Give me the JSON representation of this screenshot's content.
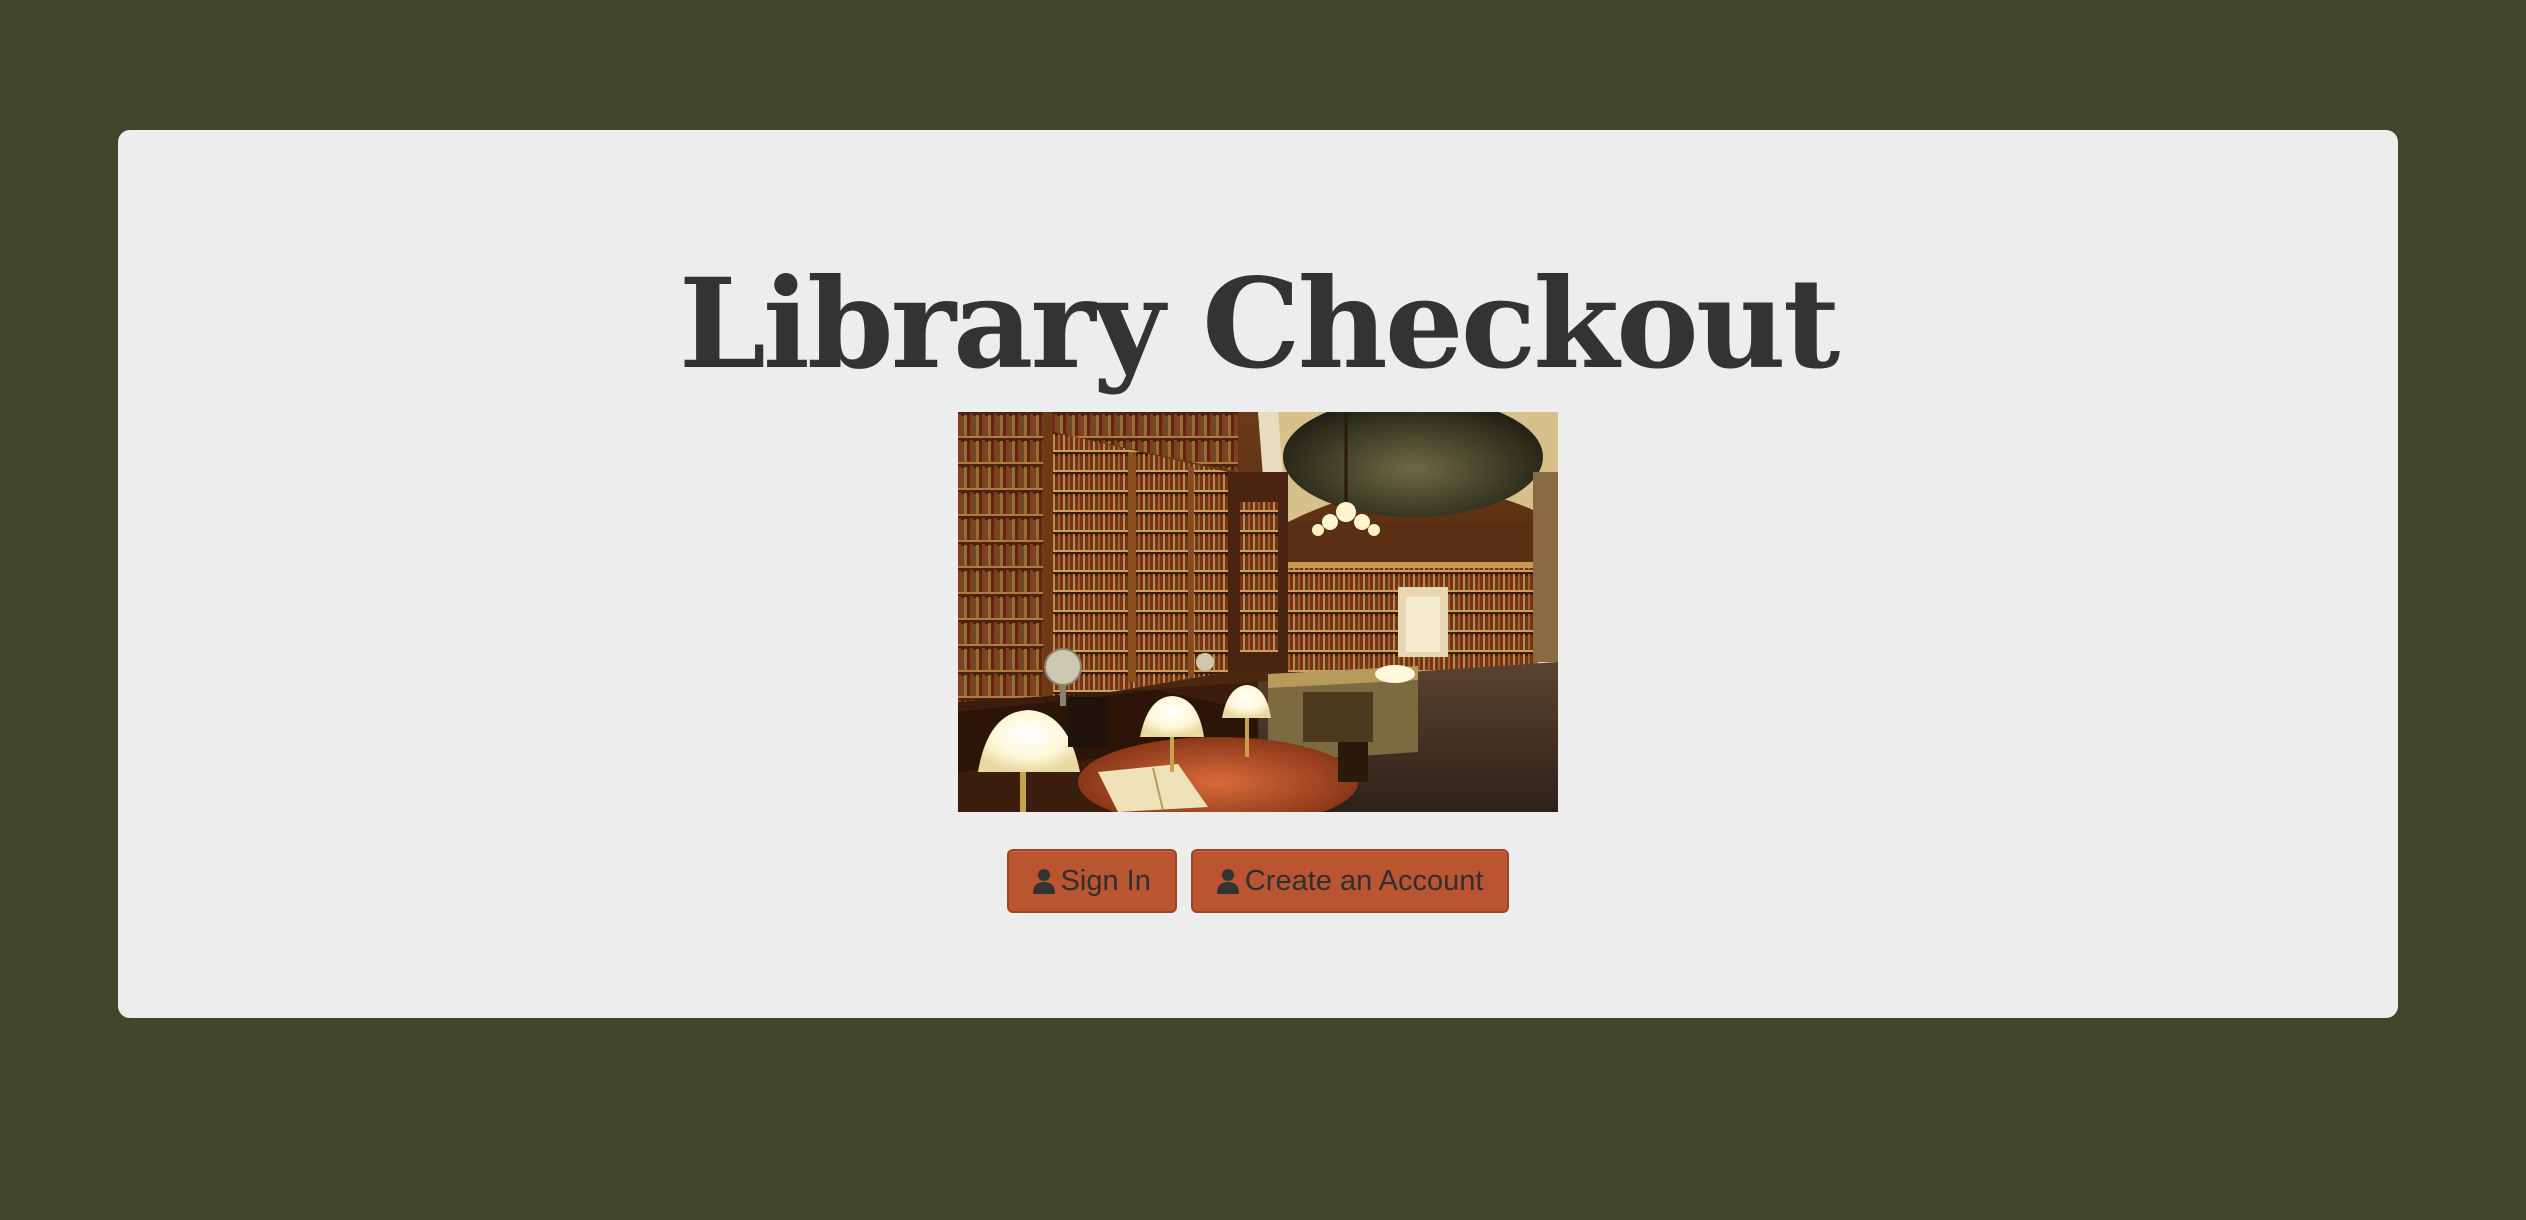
{
  "colors": {
    "background": "#41472b",
    "card": "#ededed",
    "title": "#333333",
    "button": "#bb5430",
    "button_text": "#2f2f2f"
  },
  "main": {
    "title": "Library Checkout",
    "image": {
      "icon": "library-reading-room-photo"
    },
    "buttons": [
      {
        "label": "Sign In",
        "icon": "user-icon"
      },
      {
        "label": "Create an Account",
        "icon": "user-icon"
      }
    ]
  }
}
